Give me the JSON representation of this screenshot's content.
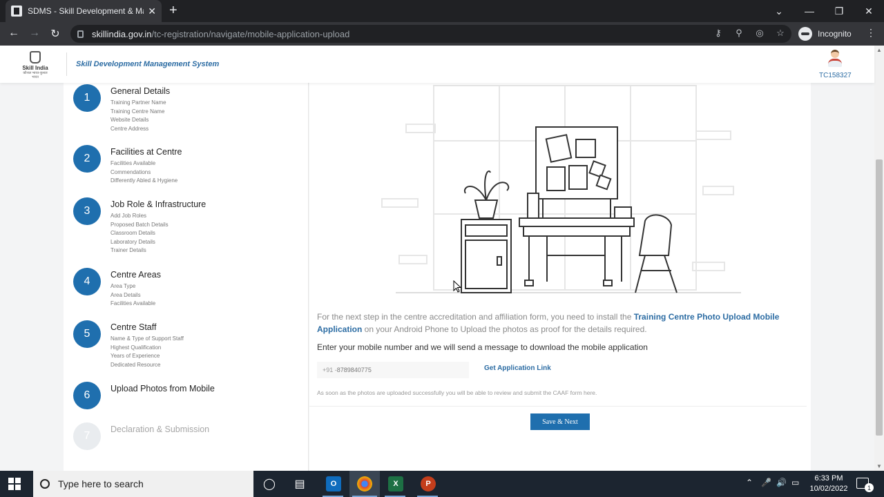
{
  "browser": {
    "tab_title": "SDMS - Skill Development & Ma",
    "tab_close": "✕",
    "new_tab": "+",
    "url_domain": "skillindia.gov.in",
    "url_path": "/tc-registration/navigate/mobile-application-upload",
    "profile_label": "Incognito",
    "minimize": "—",
    "restore": "❐",
    "close": "✕",
    "dropdown": "⌄"
  },
  "header": {
    "logo_text": "Skill India",
    "logo_tagline": "कौशल भारत-कुशल भारत",
    "system_title": "Skill Development Management System",
    "user_id": "TC158327"
  },
  "steps": [
    {
      "num": "1",
      "title": "General Details",
      "subs": [
        "Training Partner Name",
        "Training Centre Name",
        "Website Details",
        "Centre Address"
      ]
    },
    {
      "num": "2",
      "title": "Facilities at Centre",
      "subs": [
        "Facilities Available",
        "Commendations",
        "Differently Abled & Hygiene"
      ]
    },
    {
      "num": "3",
      "title": "Job Role & Infrastructure",
      "subs": [
        "Add Job Roles",
        "Proposed Batch Details",
        "Classroom Details",
        "Laboratory Details",
        "Trainer Details"
      ]
    },
    {
      "num": "4",
      "title": "Centre Areas",
      "subs": [
        "Area Type",
        "Area Details",
        "Facilities Available"
      ]
    },
    {
      "num": "5",
      "title": "Centre Staff",
      "subs": [
        "Name & Type of Support Staff",
        "Highest Qualification",
        "Years of Experience",
        "Dedicated Resource"
      ]
    },
    {
      "num": "6",
      "title": "Upload Photos from Mobile",
      "subs": []
    },
    {
      "num": "7",
      "title": "Declaration & Submission",
      "subs": []
    }
  ],
  "main": {
    "info_prefix": "For the next step in the centre accreditation and affiliation form, you need to install the ",
    "info_highlight": "Training Centre Photo Upload Mobile Application",
    "info_suffix": " on your Android Phone to Upload the photos as proof for the details required.",
    "enter_text": "Enter your mobile number and we will send a message to download the mobile application",
    "phone_prefix": "+91 - ",
    "phone_value": "8789840775",
    "get_link_label": "Get Application Link",
    "note_text": "As soon as the photos are uploaded successfully you will be able to review and submit the CAAF form here.",
    "save_label": "Save & Next"
  },
  "taskbar": {
    "search_placeholder": "Type here to search",
    "time": "6:33 PM",
    "date": "10/02/2022",
    "notification_count": "1"
  },
  "colors": {
    "accent": "#1f6fae",
    "link": "#2c6ca3",
    "taskbar": "#1c2530",
    "chrome_dark": "#202124"
  }
}
